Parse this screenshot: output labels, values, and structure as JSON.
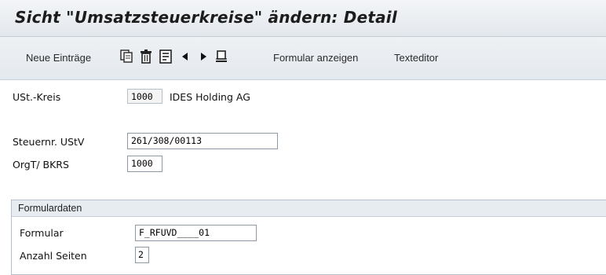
{
  "header": {
    "title": "Sicht \"Umsatzsteuerkreise\" ändern: Detail"
  },
  "toolbar": {
    "new_entries_label": "Neue Einträge",
    "form_display_label": "Formular anzeigen",
    "text_editor_label": "Texteditor"
  },
  "fields": {
    "ust_kreis": {
      "label": "USt.-Kreis",
      "value": "1000",
      "description": "IDES Holding AG"
    },
    "steuernr": {
      "label": "Steuernr. UStV",
      "value": "261/308/00113"
    },
    "orgt": {
      "label": "OrgT/ BKRS",
      "value": "1000"
    }
  },
  "form_group": {
    "title": "Formulardaten",
    "formular": {
      "label": "Formular",
      "value": "F_RFUVD____01"
    },
    "pages": {
      "label": "Anzahl Seiten",
      "value": "2"
    }
  },
  "colors": {
    "title_bg": "#e3e8ed",
    "field_border": "#8d9aa6",
    "group_header_bg": "#e7ecf1"
  }
}
